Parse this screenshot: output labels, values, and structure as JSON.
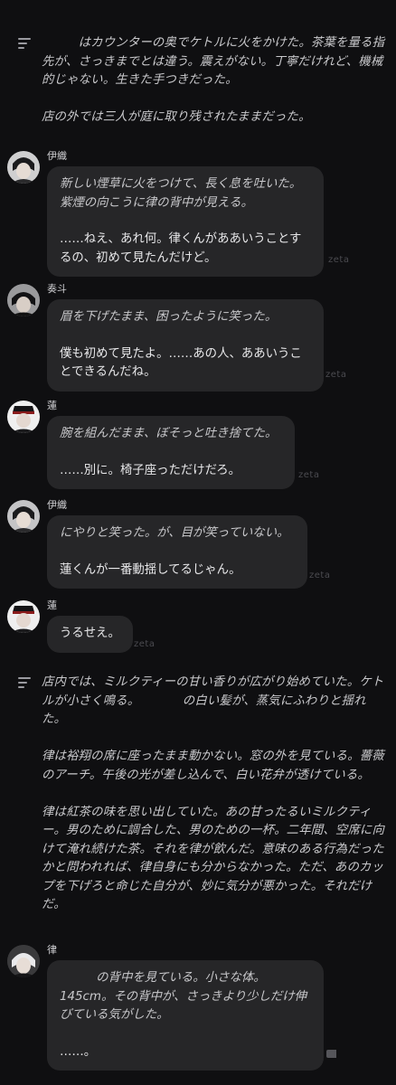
{
  "watermark": "zeta",
  "narration1": {
    "icon": "notes-icon",
    "text": "　　　はカウンターの奥でケトルに火をかけた。茶葉を量る指先が、さっきまでとは違う。震えがない。丁寧だけれど、機械的じゃない。生きた手つきだった。\n\n店の外では三人が庭に取り残されたままだった。"
  },
  "messages": [
    {
      "name": "伊織",
      "action": "新しい煙草に火をつけて、長く息を吐いた。紫煙の向こうに律の背中が見える。",
      "speech": "……ねえ、あれ何。律くんがああいうことするの、初めて見たんだけど。"
    },
    {
      "name": "奏斗",
      "action": "眉を下げたまま、困ったように笑った。",
      "speech": "僕も初めて見たよ。……あの人、ああいうことできるんだね。"
    },
    {
      "name": "蓮",
      "action": "腕を組んだまま、ぼそっと吐き捨てた。",
      "speech": "……別に。椅子座っただけだろ。"
    },
    {
      "name": "伊織",
      "action": "にやりと笑った。が、目が笑っていない。",
      "speech": "蓮くんが一番動揺してるじゃん。"
    },
    {
      "name": "蓮",
      "action": "",
      "speech": "うるせえ。"
    }
  ],
  "narration2": {
    "icon": "notes-icon",
    "text": "店内では、ミルクティーの甘い香りが広がり始めていた。ケトルが小さく鳴る。　　　　の白い髪が、蒸気にふわりと揺れた。\n\n律は裕翔の席に座ったまま動かない。窓の外を見ている。薔薇のアーチ。午後の光が差し込んで、白い花弁が透けている。\n\n律は紅茶の味を思い出していた。あの甘ったるいミルクティー。男のために調合した、男のための一杯。二年間、空席に向けて淹れ続けた茶。それを律が飲んだ。意味のある行為だったかと問われれば、律自身にも分からなかった。ただ、あのカップを下げろと命じた自分が、妙に気分が悪かった。それだけだ。"
  },
  "last": {
    "name": "律",
    "action": "　　　の背中を見ている。小さな体。145cm。その背中が、さっきより少しだけ伸びている気がした。",
    "speech": "……。"
  }
}
